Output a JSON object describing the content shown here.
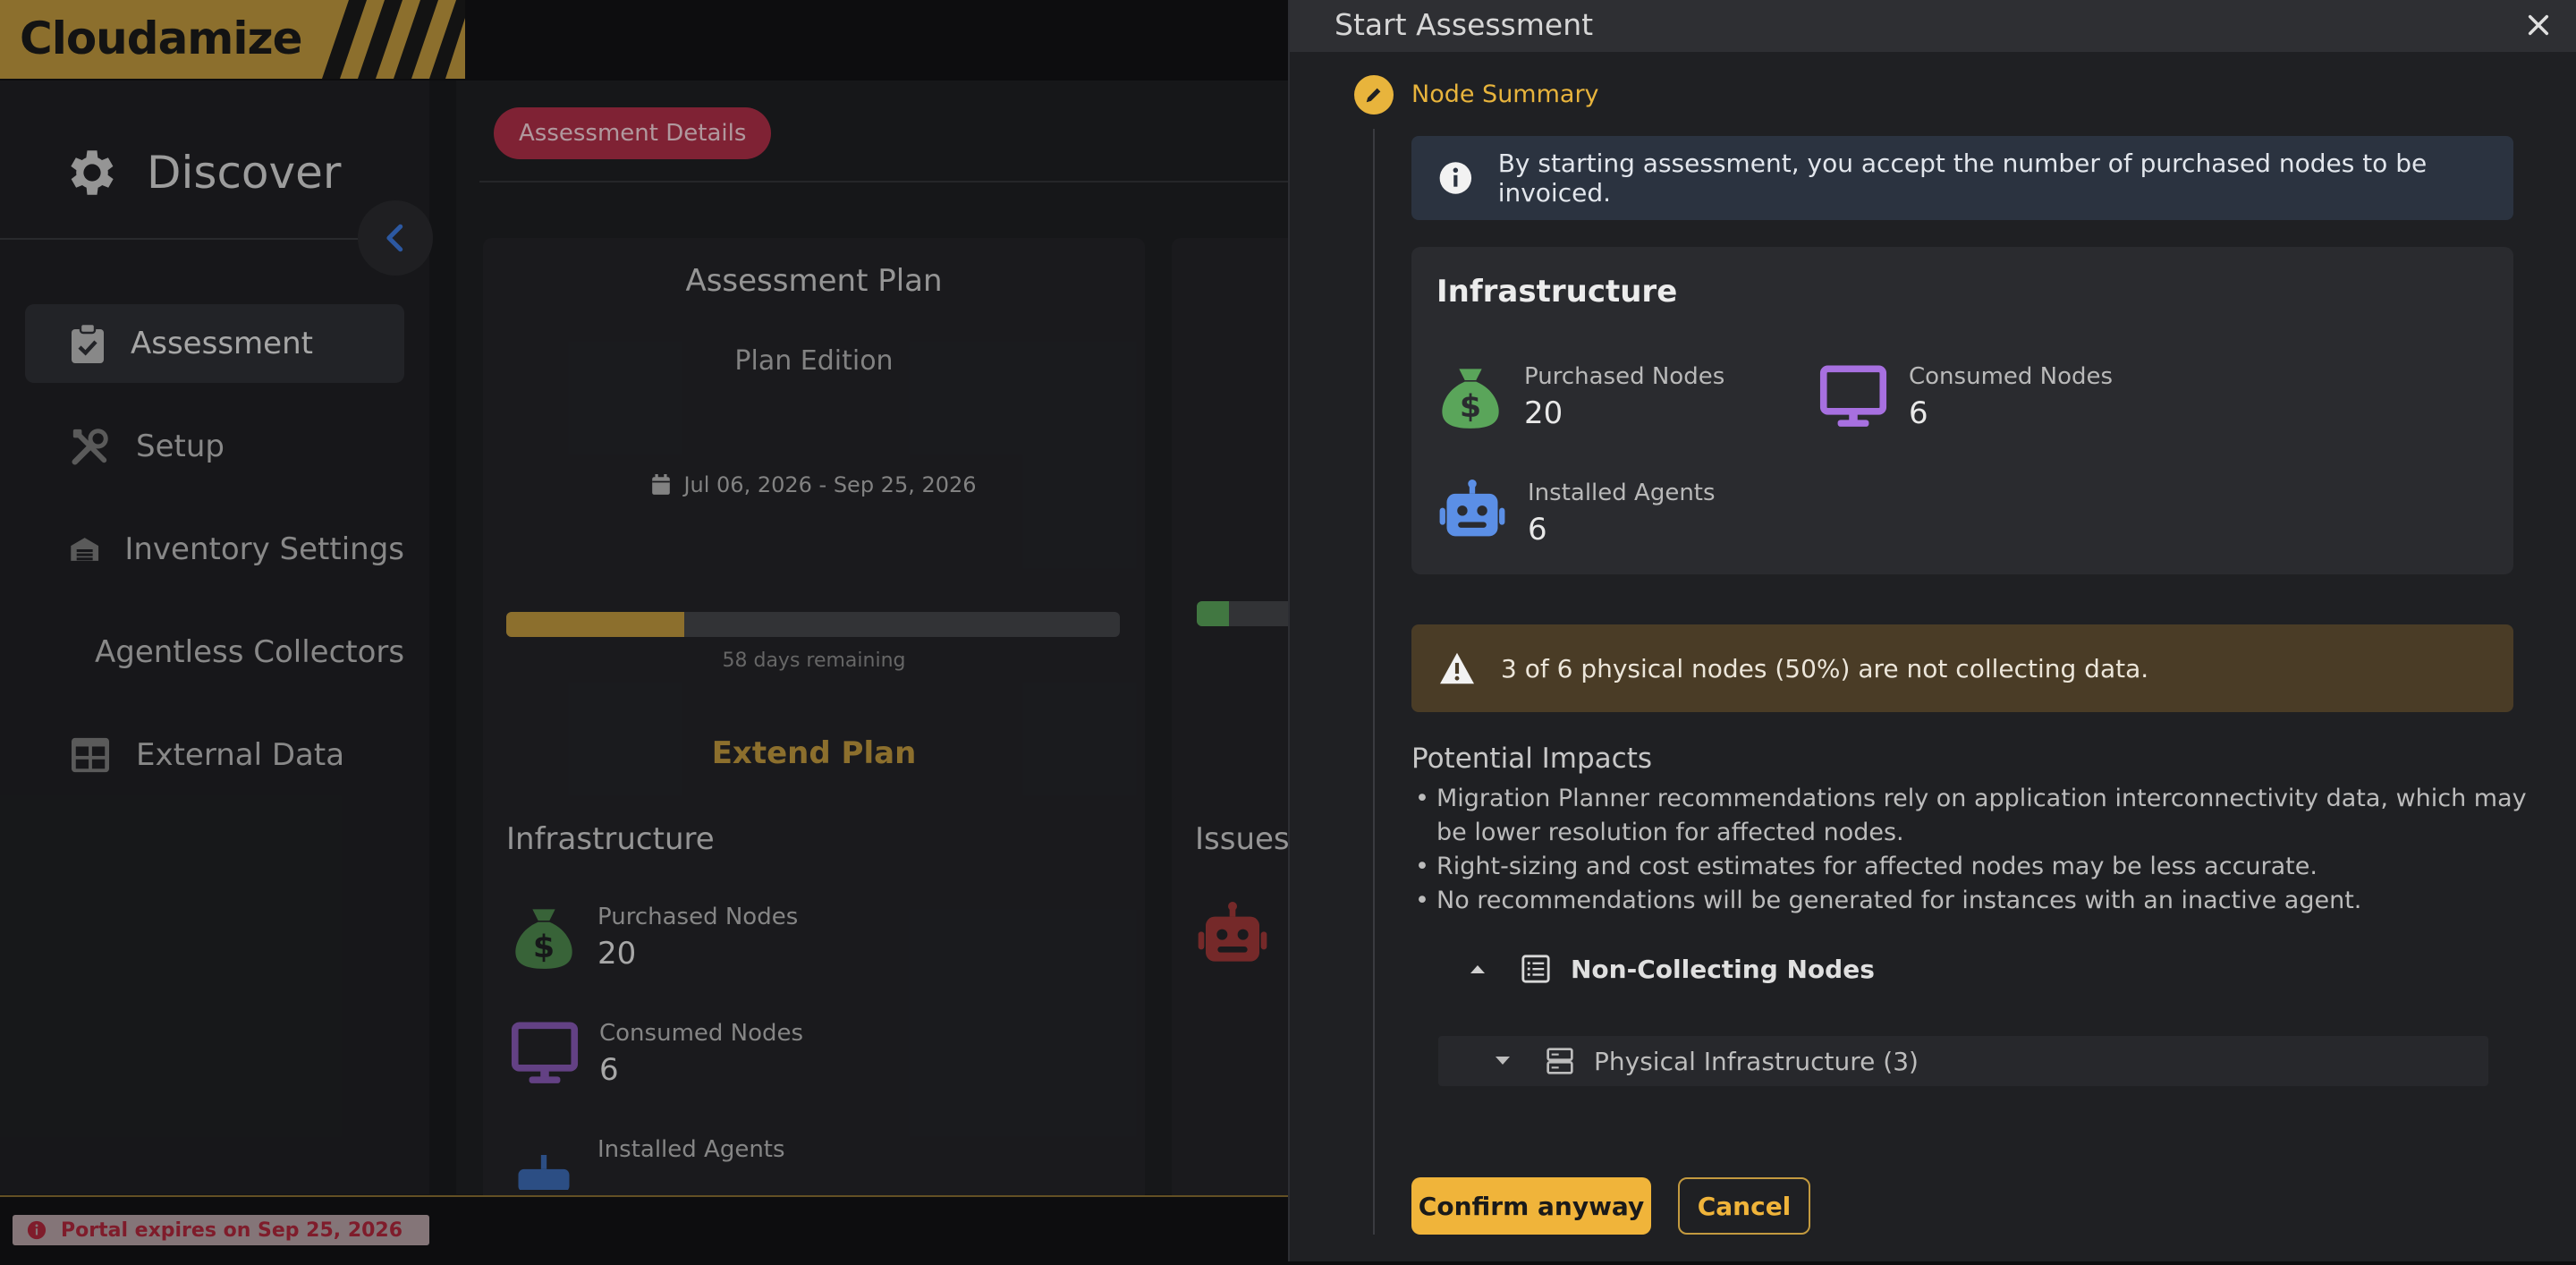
{
  "brand": {
    "name": "Cloudamize",
    "color": "#c39a3f"
  },
  "sidebar": {
    "title": "Discover",
    "title_icon": "gear-icon",
    "items": [
      {
        "label": "Assessment",
        "icon": "clipboard-check-icon",
        "active": true
      },
      {
        "label": "Setup",
        "icon": "tools-icon"
      },
      {
        "label": "Inventory Settings",
        "icon": "warehouse-icon"
      },
      {
        "label": "Agentless Collectors",
        "icon": "database-icon"
      },
      {
        "label": "External Data",
        "icon": "table-icon"
      }
    ]
  },
  "main": {
    "tab": "Assessment Details",
    "plan_card": {
      "title": "Assessment Plan",
      "edition": "Plan Edition",
      "date_range": "Jul 06, 2026 - Sep 25, 2026",
      "progress_fraction": 0.29,
      "remaining": "58 days remaining",
      "extend": "Extend Plan"
    },
    "infra_card": {
      "title": "Infrastructure",
      "purchased_label": "Purchased Nodes",
      "purchased_value": "20",
      "consumed_label": "Consumed Nodes",
      "consumed_value": "6",
      "agents_label": "Installed Agents"
    },
    "issues_card": {
      "title": "Issues"
    }
  },
  "footer": {
    "expire": "Portal expires on Sep 25, 2026"
  },
  "modal": {
    "title": "Start Assessment",
    "step": "Node Summary",
    "info": "By starting assessment, you accept the number of purchased nodes to be invoiced.",
    "infra": {
      "title": "Infrastructure",
      "purchased_label": "Purchased Nodes",
      "purchased_value": "20",
      "consumed_label": "Consumed Nodes",
      "consumed_value": "6",
      "agents_label": "Installed Agents",
      "agents_value": "6"
    },
    "warning": "3 of 6 physical nodes (50%) are not collecting data.",
    "impacts_title": "Potential Impacts",
    "impacts": [
      "Migration Planner recommendations rely on application interconnectivity data, which may be lower resolution for affected nodes.",
      "Right-sizing and cost estimates for affected nodes may be less accurate.",
      "No recommendations will be generated for instances with an inactive agent."
    ],
    "non_collecting": "Non-Collecting Nodes",
    "physical": "Physical Infrastructure (3)",
    "confirm": "Confirm anyway",
    "cancel": "Cancel"
  },
  "colors": {
    "accent": "#f0b43a",
    "danger": "#b13049",
    "money": "#5aa55a",
    "monitor": "#a770e0",
    "robot": "#5b8fe6",
    "info_bg": "#2b3340",
    "warn_bg": "#4a3c26"
  }
}
